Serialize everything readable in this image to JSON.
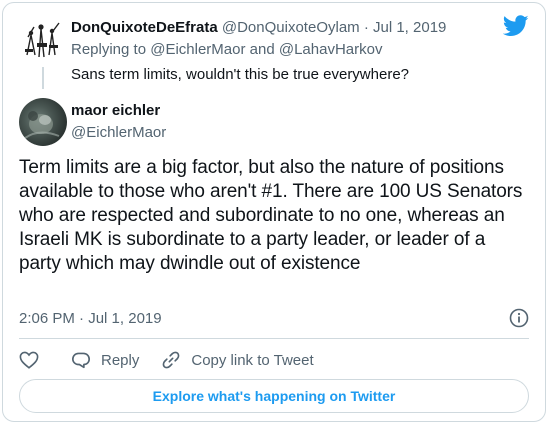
{
  "parent_tweet": {
    "name": "DonQuixoteDeEfrata",
    "handle": "@DonQuixoteOylam",
    "separator": "·",
    "date": "Jul 1, 2019",
    "replying_prefix": "Replying to",
    "reply_to_1": "@EichlerMaor",
    "and_word": "and",
    "reply_to_2": "@LahavHarkov",
    "text": "Sans term limits, wouldn't this be true everywhere?"
  },
  "main_tweet": {
    "name": "maor eichler",
    "handle": "@EichlerMaor",
    "text": "Term limits are a big factor, but also the nature of positions available to those who aren't #1. There are 100 US Senators who are respected and subordinate to no one, whereas an Israeli MK is subordinate to a party leader, or leader of a party which may dwindle out of existence",
    "time": "2:06 PM",
    "separator": "·",
    "date": "Jul 1, 2019"
  },
  "actions": {
    "reply_label": "Reply",
    "copy_link_label": "Copy link to Tweet"
  },
  "explore_label": "Explore what's happening on Twitter",
  "colors": {
    "accent": "#1d9bf0",
    "muted": "#536471",
    "border": "#cfd9de"
  },
  "icons": [
    "twitter-bird-icon",
    "info-icon",
    "heart-icon",
    "reply-icon",
    "link-icon"
  ]
}
